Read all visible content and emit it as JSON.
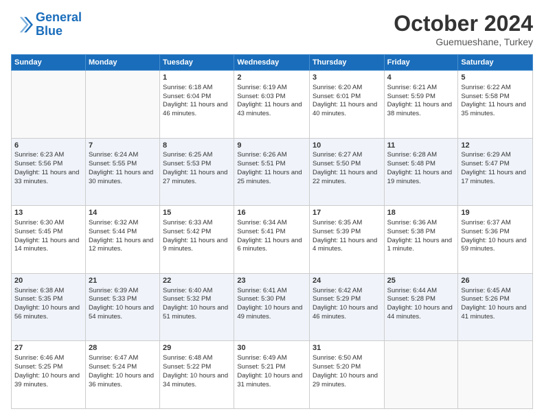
{
  "header": {
    "logo_line1": "General",
    "logo_line2": "Blue",
    "month": "October 2024",
    "location": "Guemueshane, Turkey"
  },
  "days_of_week": [
    "Sunday",
    "Monday",
    "Tuesday",
    "Wednesday",
    "Thursday",
    "Friday",
    "Saturday"
  ],
  "weeks": [
    [
      {
        "day": "",
        "info": ""
      },
      {
        "day": "",
        "info": ""
      },
      {
        "day": "1",
        "info": "Sunrise: 6:18 AM\nSunset: 6:04 PM\nDaylight: 11 hours and 46 minutes."
      },
      {
        "day": "2",
        "info": "Sunrise: 6:19 AM\nSunset: 6:03 PM\nDaylight: 11 hours and 43 minutes."
      },
      {
        "day": "3",
        "info": "Sunrise: 6:20 AM\nSunset: 6:01 PM\nDaylight: 11 hours and 40 minutes."
      },
      {
        "day": "4",
        "info": "Sunrise: 6:21 AM\nSunset: 5:59 PM\nDaylight: 11 hours and 38 minutes."
      },
      {
        "day": "5",
        "info": "Sunrise: 6:22 AM\nSunset: 5:58 PM\nDaylight: 11 hours and 35 minutes."
      }
    ],
    [
      {
        "day": "6",
        "info": "Sunrise: 6:23 AM\nSunset: 5:56 PM\nDaylight: 11 hours and 33 minutes."
      },
      {
        "day": "7",
        "info": "Sunrise: 6:24 AM\nSunset: 5:55 PM\nDaylight: 11 hours and 30 minutes."
      },
      {
        "day": "8",
        "info": "Sunrise: 6:25 AM\nSunset: 5:53 PM\nDaylight: 11 hours and 27 minutes."
      },
      {
        "day": "9",
        "info": "Sunrise: 6:26 AM\nSunset: 5:51 PM\nDaylight: 11 hours and 25 minutes."
      },
      {
        "day": "10",
        "info": "Sunrise: 6:27 AM\nSunset: 5:50 PM\nDaylight: 11 hours and 22 minutes."
      },
      {
        "day": "11",
        "info": "Sunrise: 6:28 AM\nSunset: 5:48 PM\nDaylight: 11 hours and 19 minutes."
      },
      {
        "day": "12",
        "info": "Sunrise: 6:29 AM\nSunset: 5:47 PM\nDaylight: 11 hours and 17 minutes."
      }
    ],
    [
      {
        "day": "13",
        "info": "Sunrise: 6:30 AM\nSunset: 5:45 PM\nDaylight: 11 hours and 14 minutes."
      },
      {
        "day": "14",
        "info": "Sunrise: 6:32 AM\nSunset: 5:44 PM\nDaylight: 11 hours and 12 minutes."
      },
      {
        "day": "15",
        "info": "Sunrise: 6:33 AM\nSunset: 5:42 PM\nDaylight: 11 hours and 9 minutes."
      },
      {
        "day": "16",
        "info": "Sunrise: 6:34 AM\nSunset: 5:41 PM\nDaylight: 11 hours and 6 minutes."
      },
      {
        "day": "17",
        "info": "Sunrise: 6:35 AM\nSunset: 5:39 PM\nDaylight: 11 hours and 4 minutes."
      },
      {
        "day": "18",
        "info": "Sunrise: 6:36 AM\nSunset: 5:38 PM\nDaylight: 11 hours and 1 minute."
      },
      {
        "day": "19",
        "info": "Sunrise: 6:37 AM\nSunset: 5:36 PM\nDaylight: 10 hours and 59 minutes."
      }
    ],
    [
      {
        "day": "20",
        "info": "Sunrise: 6:38 AM\nSunset: 5:35 PM\nDaylight: 10 hours and 56 minutes."
      },
      {
        "day": "21",
        "info": "Sunrise: 6:39 AM\nSunset: 5:33 PM\nDaylight: 10 hours and 54 minutes."
      },
      {
        "day": "22",
        "info": "Sunrise: 6:40 AM\nSunset: 5:32 PM\nDaylight: 10 hours and 51 minutes."
      },
      {
        "day": "23",
        "info": "Sunrise: 6:41 AM\nSunset: 5:30 PM\nDaylight: 10 hours and 49 minutes."
      },
      {
        "day": "24",
        "info": "Sunrise: 6:42 AM\nSunset: 5:29 PM\nDaylight: 10 hours and 46 minutes."
      },
      {
        "day": "25",
        "info": "Sunrise: 6:44 AM\nSunset: 5:28 PM\nDaylight: 10 hours and 44 minutes."
      },
      {
        "day": "26",
        "info": "Sunrise: 6:45 AM\nSunset: 5:26 PM\nDaylight: 10 hours and 41 minutes."
      }
    ],
    [
      {
        "day": "27",
        "info": "Sunrise: 6:46 AM\nSunset: 5:25 PM\nDaylight: 10 hours and 39 minutes."
      },
      {
        "day": "28",
        "info": "Sunrise: 6:47 AM\nSunset: 5:24 PM\nDaylight: 10 hours and 36 minutes."
      },
      {
        "day": "29",
        "info": "Sunrise: 6:48 AM\nSunset: 5:22 PM\nDaylight: 10 hours and 34 minutes."
      },
      {
        "day": "30",
        "info": "Sunrise: 6:49 AM\nSunset: 5:21 PM\nDaylight: 10 hours and 31 minutes."
      },
      {
        "day": "31",
        "info": "Sunrise: 6:50 AM\nSunset: 5:20 PM\nDaylight: 10 hours and 29 minutes."
      },
      {
        "day": "",
        "info": ""
      },
      {
        "day": "",
        "info": ""
      }
    ]
  ]
}
